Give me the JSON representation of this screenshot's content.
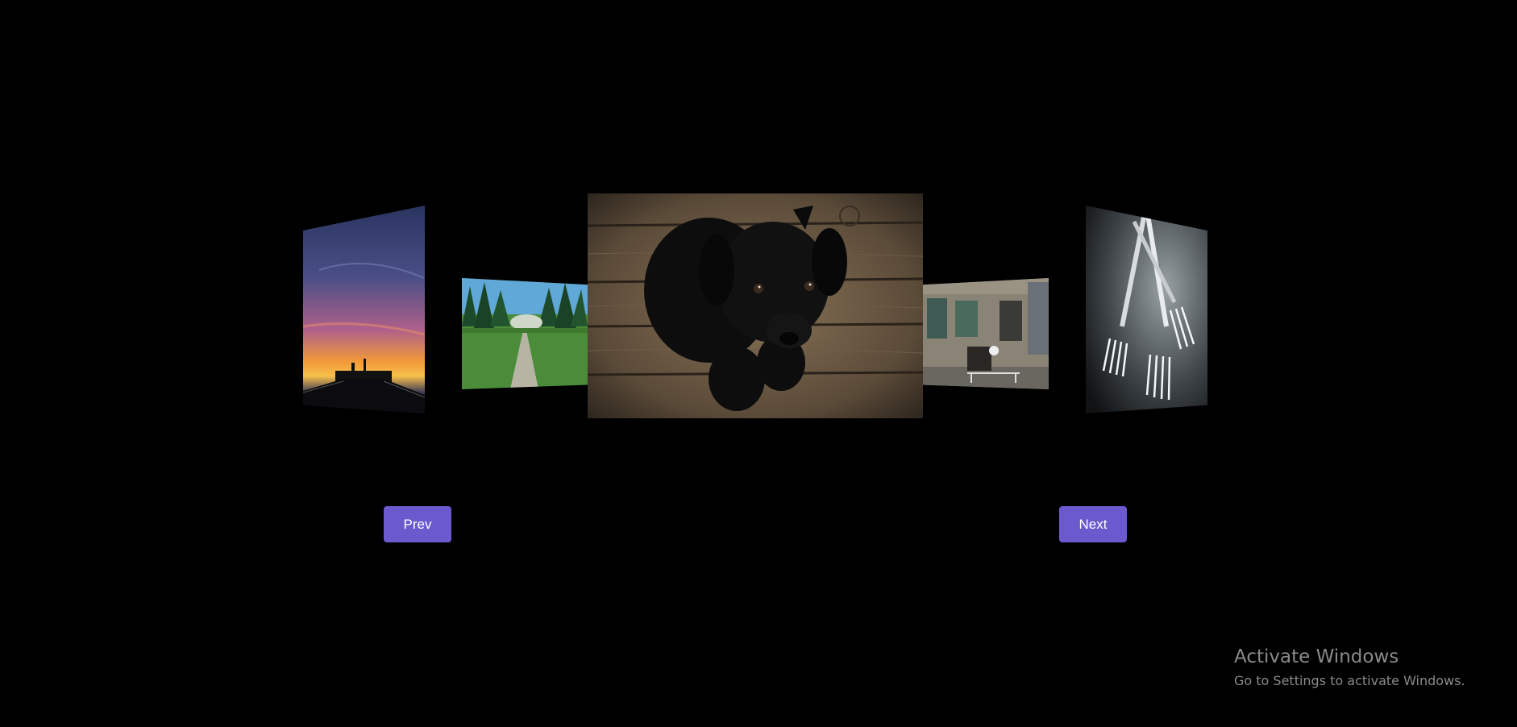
{
  "carousel": {
    "slides": [
      {
        "name": "sunset-pier-image",
        "subject": "sunset over pier"
      },
      {
        "name": "forest-path-image",
        "subject": "forest path"
      },
      {
        "name": "black-puppy-image",
        "subject": "black puppy on wooden floor"
      },
      {
        "name": "old-building-image",
        "subject": "old building street"
      },
      {
        "name": "forks-image",
        "subject": "forks"
      }
    ],
    "active_index": 2
  },
  "controls": {
    "prev_label": "Prev",
    "next_label": "Next",
    "button_color": "#6a5acd"
  },
  "watermark": {
    "title": "Activate Windows",
    "subtitle": "Go to Settings to activate Windows."
  }
}
